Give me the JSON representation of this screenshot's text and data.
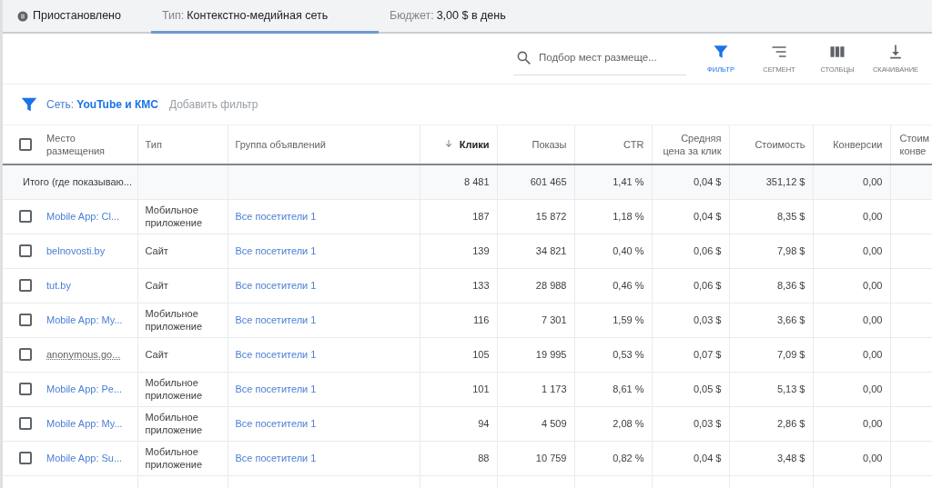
{
  "status": {
    "label": "Приостановлено",
    "paused": true
  },
  "summary_tabs": [
    {
      "label": "Тип:",
      "value": "Контекстно-медийная сеть",
      "selected": true
    },
    {
      "label": "Бюджет:",
      "value": "3,00 $ в день",
      "selected": false
    }
  ],
  "toolbar": {
    "search": {
      "placeholder": "Подбор мест размеще..."
    },
    "buttons": [
      {
        "label": "ФИЛЬТР",
        "kind": "filter",
        "selected": true
      },
      {
        "label": "СЕГМЕНТ",
        "kind": "segment",
        "selected": false
      },
      {
        "label": "СТОЛБЦЫ",
        "kind": "columns",
        "selected": false
      },
      {
        "label": "СКАЧИВАНИЕ",
        "kind": "download",
        "selected": false
      }
    ]
  },
  "filter_bar": {
    "filter_label": "Сеть:",
    "filter_value": "YouTube и КМС",
    "add_filter": "Добавить фильтр"
  },
  "table": {
    "select_all_checked": false,
    "columns": [
      {
        "label": "Место размещения",
        "sorted": false
      },
      {
        "label": "Тип",
        "sorted": false
      },
      {
        "label": "Группа объявлений",
        "sorted": false
      },
      {
        "label": "Клики",
        "sorted": true
      },
      {
        "label": "Показы",
        "sorted": false
      },
      {
        "label": "CTR",
        "sorted": false
      },
      {
        "label": "Средняя цена за клик",
        "sorted": false
      },
      {
        "label": "Стоимость",
        "sorted": false
      },
      {
        "label": "Конверсии",
        "sorted": false
      },
      {
        "label": "Стоим конве",
        "sorted": false
      }
    ],
    "total": {
      "cells": [
        "Итого (где показываю...",
        "",
        "",
        "8 481",
        "601 465",
        "1,41 %",
        "0,04 $",
        "351,12 $",
        "0,00"
      ]
    },
    "rows": [
      {
        "checked": false,
        "link": true,
        "cells": [
          "Mobile App: Cl...",
          "Мобильное приложение",
          "Все посетители 1",
          "187",
          "15 872",
          "1,18 %",
          "0,04 $",
          "8,35 $",
          "0,00"
        ]
      },
      {
        "checked": false,
        "link": true,
        "cells": [
          "belnovosti.by",
          "Сайт",
          "Все посетители 1",
          "139",
          "34 821",
          "0,40 %",
          "0,06 $",
          "7,98 $",
          "0,00"
        ]
      },
      {
        "checked": false,
        "link": true,
        "cells": [
          "tut.by",
          "Сайт",
          "Все посетители 1",
          "133",
          "28 988",
          "0,46 %",
          "0,06 $",
          "8,36 $",
          "0,00"
        ]
      },
      {
        "checked": false,
        "link": true,
        "cells": [
          "Mobile App: My...",
          "Мобильное приложение",
          "Все посетители 1",
          "116",
          "7 301",
          "1,59 %",
          "0,03 $",
          "3,66 $",
          "0,00"
        ]
      },
      {
        "checked": false,
        "link": false,
        "cells": [
          "anonymous.go...",
          "Сайт",
          "Все посетители 1",
          "105",
          "19 995",
          "0,53 %",
          "0,07 $",
          "7,09 $",
          "0,00"
        ]
      },
      {
        "checked": false,
        "link": true,
        "cells": [
          "Mobile App: Pe...",
          "Мобильное приложение",
          "Все посетители 1",
          "101",
          "1 173",
          "8,61 %",
          "0,05 $",
          "5,13 $",
          "0,00"
        ]
      },
      {
        "checked": false,
        "link": true,
        "cells": [
          "Mobile App: My...",
          "Мобильное приложение",
          "Все посетители 1",
          "94",
          "4 509",
          "2,08 %",
          "0,03 $",
          "2,86 $",
          "0,00"
        ]
      },
      {
        "checked": false,
        "link": true,
        "cells": [
          "Mobile App: Su...",
          "Мобильное приложение",
          "Все посетители 1",
          "88",
          "10 759",
          "0,82 %",
          "0,04 $",
          "3,48 $",
          "0,00"
        ]
      }
    ]
  }
}
